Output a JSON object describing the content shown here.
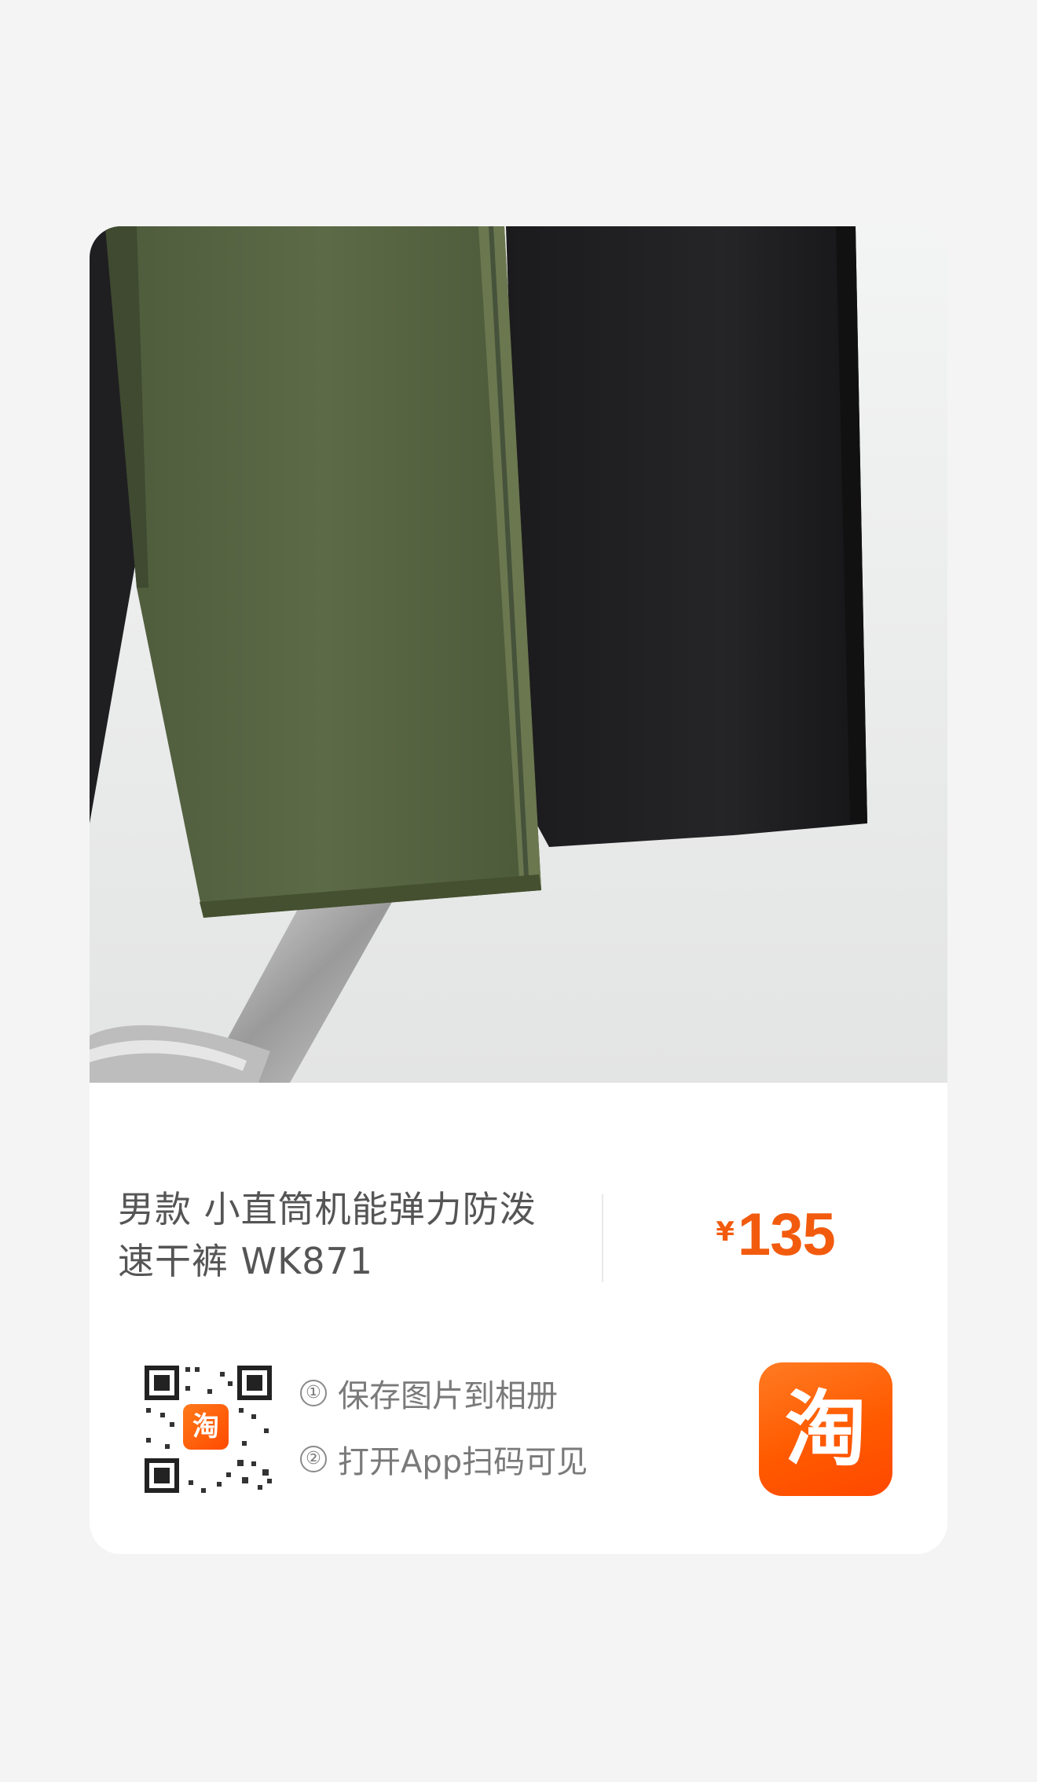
{
  "product": {
    "title_line1": "男款 小直筒机能弹力防泼",
    "title_line2": "速干裤 WK871",
    "currency_symbol": "¥",
    "price": "135"
  },
  "share": {
    "step1_num": "①",
    "step1_text": "保存图片到相册",
    "step2_num": "②",
    "step2_text": "打开App扫码可见",
    "qr_logo_glyph": "淘",
    "app_icon_glyph": "淘"
  },
  "colors": {
    "price": "#f25b0e",
    "brand": "#ff5a00",
    "background": "#f4f4f4"
  },
  "icons": {
    "qr_code": "qr-code-icon",
    "app_logo": "taobao-app-icon"
  }
}
